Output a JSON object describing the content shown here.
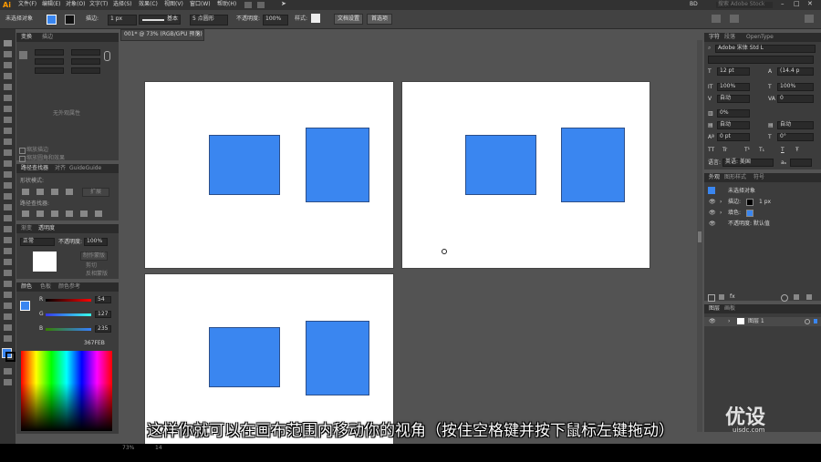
{
  "app": {
    "logo": "Ai"
  },
  "menu": [
    "文件(F)",
    "编辑(E)",
    "对象(O)",
    "文字(T)",
    "选择(S)",
    "效果(C)",
    "视图(V)",
    "窗口(W)",
    "帮助(H)"
  ],
  "menu_right": {
    "workspace": "BD",
    "search_placeholder": "搜索 Adobe Stock"
  },
  "control": {
    "selection_label": "未选择对象",
    "stroke_label": "描边:",
    "stroke_value": "1 px",
    "brush_label": "基本",
    "profile_label": "5 点圆形",
    "opacity_label": "不透明度:",
    "opacity_value": "100%",
    "style_label": "样式:",
    "doc_setup": "文档设置",
    "prefs": "首选项"
  },
  "document": {
    "tab_title": "001* @ 73% (RGB/GPU 预览)"
  },
  "left_panels": {
    "top_tabs": [
      "变换",
      "描边"
    ],
    "empty_text": "无外观属性",
    "check1": "缩放描边",
    "check2": "缩放圆角和效果",
    "pathfinder_tabs": [
      "路径查找器",
      "对齐",
      "GuideGuide"
    ],
    "shape_modes": "形状模式:",
    "expand": "扩展",
    "pathfinders": "路径查找器:",
    "transparency_tabs": [
      "渐变",
      "透明度"
    ],
    "blend_mode": "正常",
    "opacity_label": "不透明度:",
    "opacity_value": "100%",
    "make_mask": "制作蒙版",
    "clip": "剪切",
    "invert": "反相蒙版",
    "color_tabs": [
      "颜色",
      "色板",
      "颜色参考"
    ],
    "color_vals": {
      "r": "54",
      "g": "127",
      "b": "235"
    },
    "hex": "367FEB"
  },
  "right_panels": {
    "char_tabs": [
      "字符",
      "段落",
      "OpenType"
    ],
    "font_family": "Adobe 宋体 Std L",
    "font_size": "12 pt",
    "leading": "(14.4 p",
    "scale_v": "100%",
    "scale_h": "100%",
    "kern": "自动",
    "tracking": "0",
    "pct": "0%",
    "auto": "自动",
    "zero_pt": "0 pt",
    "zero_deg": "0°",
    "tt_buttons": [
      "TT",
      "Tr",
      "T¹",
      "T₁",
      "T",
      "Ŧ"
    ],
    "lang_label": "语言:",
    "lang": "英语: 美国",
    "aa": "aₐ",
    "appearance_tabs": [
      "外观",
      "图形样式",
      "符号"
    ],
    "appearance_title": "未选择对象",
    "stroke_label": "描边:",
    "stroke_value": "1 px",
    "fill_label": "填色:",
    "opacity_row": "不透明度: 默认值",
    "layers_tabs": [
      "图层",
      "画板"
    ],
    "layer_name": "图层 1"
  },
  "status": {
    "zoom": "73%",
    "page": "14"
  },
  "subtitle": "这样你就可以在画布范围内移动你的视角（按住空格键并按下鼠标左键拖动）",
  "watermark": {
    "name": "优设",
    "url": "uisdc.com"
  },
  "colors": {
    "accent": "#3a86f0",
    "canvas": "#535353",
    "panel": "#3c3c3c"
  }
}
